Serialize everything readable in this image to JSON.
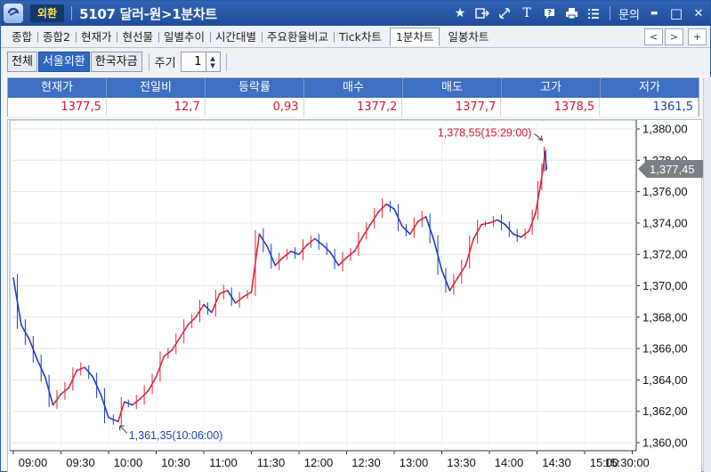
{
  "window": {
    "title_badge": "외환",
    "title": "5107 달러-원>1분차트",
    "tools": [
      "star-icon",
      "export-icon",
      "link-icon",
      "text-icon",
      "help-icon",
      "print-icon",
      "list-icon"
    ],
    "inquiry_label": "문의",
    "minimize": "▬",
    "maximize": "□",
    "close": "✕"
  },
  "tabs": [
    "종합",
    "종합2",
    "현재가",
    "현선물",
    "일별추이",
    "시간대별",
    "주요환율비교",
    "Tick차트",
    "1분차트",
    "일봉차트"
  ],
  "active_tab": "1분차트",
  "tab_nav": {
    "prev": "<",
    "next": ">",
    "add": "+"
  },
  "filters": {
    "segments": [
      "전체",
      "서울외환",
      "한국자금"
    ],
    "active_segment": "서울외환",
    "period_label": "주기",
    "period_value": "1"
  },
  "quote": {
    "headers": [
      "현재가",
      "전일비",
      "등락률",
      "매수",
      "매도",
      "고가",
      "저가"
    ],
    "values": [
      "1377,5",
      "12,7",
      "0,93",
      "1377,2",
      "1377,7",
      "1378,5",
      "1361,5"
    ],
    "colors": [
      "#d4172c",
      "#d4172c",
      "#d4172c",
      "#d4172c",
      "#d4172c",
      "#d4172c",
      "#1c3fb8"
    ]
  },
  "chart_data": {
    "type": "line",
    "x_ticks": [
      "09:00",
      "09:30",
      "10:00",
      "10:30",
      "11:00",
      "11:30",
      "12:00",
      "12:30",
      "13:00",
      "13:30",
      "14:00",
      "14:30",
      "15:00",
      "15:30:00"
    ],
    "y_ticks": [
      "1,380,00",
      "1,378,00",
      "1,376,00",
      "1,374,00",
      "1,372,00",
      "1,370,00",
      "1,368,00",
      "1,366,00",
      "1,364,00",
      "1,362,00",
      "1,360,00"
    ],
    "ylim": [
      1360,
      1380
    ],
    "grid": true,
    "up_color": "#e0263a",
    "down_color": "#1f3dc8",
    "series": [
      {
        "x": [
          0,
          5,
          10,
          15,
          20,
          25,
          30,
          35,
          40,
          45,
          50,
          55,
          60,
          66,
          70,
          75,
          80,
          85,
          90,
          95,
          100,
          105,
          110,
          115,
          120,
          125,
          130,
          135,
          140,
          145,
          150,
          155,
          160,
          165,
          170,
          175,
          180,
          185,
          190,
          195,
          200,
          205,
          210,
          215,
          220,
          225,
          230,
          235,
          240,
          245,
          250,
          255,
          260,
          265,
          270,
          275,
          280,
          285,
          290,
          295,
          300,
          305,
          310,
          315,
          320,
          325,
          329,
          332,
          334,
          335,
          336
        ],
        "y": [
          1370.5,
          1367.5,
          1366.6,
          1365.3,
          1364.2,
          1362.4,
          1363.1,
          1363.5,
          1364.6,
          1364.8,
          1364.2,
          1363.1,
          1361.6,
          1361.35,
          1362.6,
          1362.4,
          1362.8,
          1363.3,
          1364.2,
          1365.5,
          1365.9,
          1366.7,
          1367.5,
          1368.0,
          1368.8,
          1368.3,
          1369.5,
          1369.7,
          1368.9,
          1369.3,
          1369.6,
          1373.3,
          1372.5,
          1371.3,
          1371.8,
          1372.2,
          1372.0,
          1372.6,
          1373.0,
          1372.6,
          1372.1,
          1371.3,
          1371.8,
          1372.2,
          1373.1,
          1373.9,
          1374.7,
          1375.2,
          1374.9,
          1373.8,
          1373.3,
          1374.1,
          1374.4,
          1372.9,
          1371.0,
          1369.7,
          1370.5,
          1371.3,
          1373.0,
          1373.9,
          1374.0,
          1374.2,
          1373.9,
          1373.3,
          1373.1,
          1373.5,
          1374.6,
          1376.3,
          1377.6,
          1378.55,
          1377.45
        ]
      }
    ],
    "annotations": [
      {
        "label": "1,378,55(15:29:00)",
        "x": 335,
        "y": 1378.55,
        "color": "#d4172c"
      },
      {
        "label": "1,361,35(10:06:00)",
        "x": 66,
        "y": 1361.35,
        "color": "#1c3fb8"
      }
    ],
    "last_price_label": "1,377,45",
    "last_price": 1377.45
  }
}
